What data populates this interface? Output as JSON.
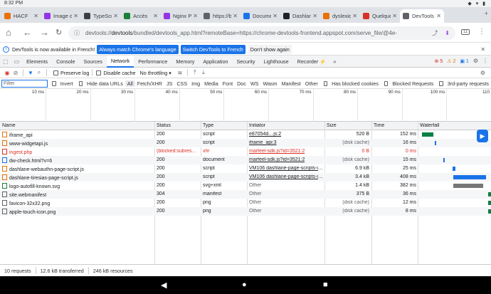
{
  "status_bar": {
    "time": "8:32 PM",
    "icons": "◆ ▾ ▮"
  },
  "tabs": [
    {
      "label": "HACF",
      "color": "#e8710a",
      "active": false
    },
    {
      "label": "Image de",
      "color": "#9334e6",
      "active": false
    },
    {
      "label": "TypeScript",
      "color": "#3c4043",
      "active": false
    },
    {
      "label": "Accès",
      "color": "#188038",
      "active": false
    },
    {
      "label": "Nginx Prox",
      "color": "#9334e6",
      "active": false
    },
    {
      "label": "https://blo",
      "color": "#5f6368",
      "active": false
    },
    {
      "label": "Document",
      "color": "#1a73e8",
      "active": false
    },
    {
      "label": "Dashlane",
      "color": "#202124",
      "active": false
    },
    {
      "label": "dyslexique",
      "color": "#e8710a",
      "active": false
    },
    {
      "label": "Quelques",
      "color": "#d93025",
      "active": false
    },
    {
      "label": "DevTools",
      "color": "#5f6368",
      "active": true
    }
  ],
  "omnibox": {
    "host": "devtools://",
    "url_bold": "devtools",
    "url_rest": "/bundled/devtools_app.html?remoteBase=https://chrome-devtools-frontend.appspot.com/serve_file/@4e-",
    "tab_count": "11"
  },
  "infobar": {
    "message": "DevTools is now available in French!",
    "btn_match": "Always match Chrome's language",
    "btn_switch": "Switch DevTools to French",
    "btn_dismiss": "Don't show again"
  },
  "devtools_tabs": [
    "Elements",
    "Console",
    "Sources",
    "Network",
    "Performance",
    "Memory",
    "Application",
    "Security",
    "Lighthouse",
    "Recorder ⚡"
  ],
  "active_devtools_tab": "Network",
  "badges": {
    "errors": "5",
    "warnings": "2",
    "info": "1"
  },
  "toolbar": {
    "preserve_log": "Preserve log",
    "disable_cache": "Disable cache",
    "throttling": "No throttling"
  },
  "filter_bar": {
    "placeholder": "Filter",
    "invert": "Invert",
    "hide_data_urls": "Hide data URLs",
    "types": [
      "All",
      "Fetch/XHR",
      "JS",
      "CSS",
      "Img",
      "Media",
      "Font",
      "Doc",
      "WS",
      "Wasm",
      "Manifest",
      "Other"
    ],
    "active_type": "All",
    "has_blocked_cookies": "Has blocked cookies",
    "blocked_requests": "Blocked Requests",
    "third_party": "3rd-party requests"
  },
  "timeline_ticks": [
    "10 ms",
    "20 ms",
    "30 ms",
    "40 ms",
    "50 ms",
    "60 ms",
    "70 ms",
    "80 ms",
    "90 ms",
    "100 ms",
    "110"
  ],
  "columns": {
    "name": "Name",
    "status": "Status",
    "type": "Type",
    "initiator": "Initiator",
    "size": "Size",
    "time": "Time",
    "waterfall": "Waterfall"
  },
  "requests": [
    {
      "name": "iframe_api",
      "status": "200",
      "type": "script",
      "initiator": "e87054d…js:2",
      "size": "520 B",
      "time": "152 ms",
      "error": false,
      "initiator_link": true,
      "icon": "#e8710a"
    },
    {
      "name": "www-widgetapi.js",
      "status": "200",
      "type": "script",
      "initiator": "iframe_api:3",
      "size": "(disk cache)",
      "time": "16 ms",
      "error": false,
      "initiator_link": true,
      "icon": "#e8710a"
    },
    {
      "name": "ingest.php",
      "status": "(blocked:subreso…",
      "type": "xhr",
      "initiator": "marfeel-sdk.js?id=3521:2",
      "size": "0 B",
      "time": "0 ms",
      "error": true,
      "initiator_link": true,
      "icon": "#d93025"
    },
    {
      "name": "dw-check.html?v=6",
      "status": "200",
      "type": "document",
      "initiator": "marfeel-sdk.js?id=3521:2",
      "size": "(disk cache)",
      "time": "15 ms",
      "error": false,
      "initiator_link": true,
      "icon": "#1a73e8"
    },
    {
      "name": "dashlane-webauthn-page-script.js",
      "status": "200",
      "type": "script",
      "initiator": "VM106 dashlane-page-scripts-in…",
      "size": "6.9 kB",
      "time": "25 ms",
      "error": false,
      "initiator_link": true,
      "icon": "#e8710a"
    },
    {
      "name": "dashlane-tiresias-page-script.js",
      "status": "200",
      "type": "script",
      "initiator": "VM106 dashlane-page-scripts-in…",
      "size": "3.4 kB",
      "time": "408 ms",
      "error": false,
      "initiator_link": true,
      "icon": "#e8710a"
    },
    {
      "name": "logo-autofill-known.svg",
      "status": "200",
      "type": "svg+xml",
      "initiator": "Other",
      "size": "1.4 kB",
      "time": "382 ms",
      "error": false,
      "initiator_link": false,
      "icon": "#188038"
    },
    {
      "name": "site.webmanifest",
      "status": "304",
      "type": "manifest",
      "initiator": "Other",
      "size": "375 B",
      "time": "36 ms",
      "error": false,
      "initiator_link": false,
      "icon": "#5f6368"
    },
    {
      "name": "favicon-32x32.png",
      "status": "200",
      "type": "png",
      "initiator": "Other",
      "size": "(disk cache)",
      "time": "12 ms",
      "error": false,
      "initiator_link": false,
      "icon": "#5f6368"
    },
    {
      "name": "apple-touch-icon.png",
      "status": "200",
      "type": "png",
      "initiator": "Other",
      "size": "(disk cache)",
      "time": "8 ms",
      "error": false,
      "initiator_link": false,
      "icon": "#5f6368"
    }
  ],
  "footer": {
    "requests": "10 requests",
    "transferred": "12.6 kB transferred",
    "resources": "246 kB resources"
  },
  "colors": {
    "accent": "#1a73e8",
    "error": "#d93025",
    "warning": "#e37400"
  }
}
